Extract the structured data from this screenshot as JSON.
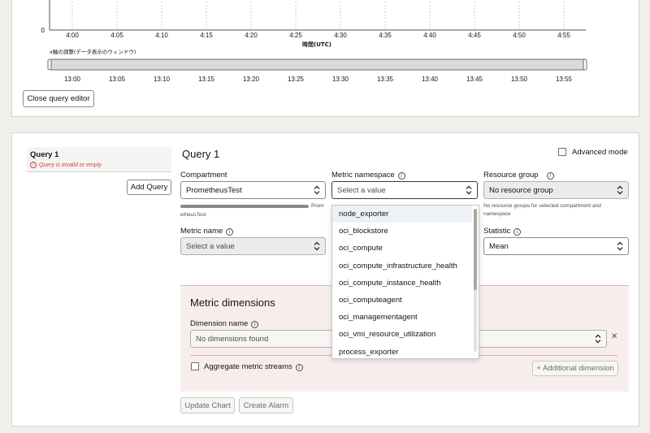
{
  "chart": {
    "x_ticks_local": [
      "4:00",
      "4:05",
      "4:10",
      "4:15",
      "4:20",
      "4:25",
      "4:30",
      "4:35",
      "4:40",
      "4:45",
      "4:50",
      "4:55"
    ],
    "y_zero_label": "0",
    "x_axis_title": "時間(UTC)",
    "window_title": "x軸の調整(データ表示のウィンドウ)",
    "window_ticks": [
      "13:00",
      "13:05",
      "13:10",
      "13:15",
      "13:20",
      "13:25",
      "13:30",
      "13:35",
      "13:40",
      "13:45",
      "13:50",
      "13:55"
    ]
  },
  "close_editor_label": "Close query editor",
  "sidebar": {
    "query_label": "Query 1",
    "error_text": "Query is invalid or empty",
    "add_query_label": "Add Query"
  },
  "query": {
    "title": "Query 1",
    "advanced_mode_label": "Advanced mode",
    "compartment_label": "Compartment",
    "compartment_value": "PrometheusTest",
    "compartment_path_tail": "Prom",
    "compartment_path_end": "etheusTest",
    "namespace_label": "Metric namespace",
    "namespace_placeholder": "Select a value",
    "resource_group_label": "Resource group",
    "resource_group_value": "No resource group",
    "resource_group_hint_1": "No resource groups for selected compartment and",
    "resource_group_hint_2": "namespace",
    "metric_name_label": "Metric name",
    "metric_name_placeholder": "Select a value",
    "statistic_label": "Statistic",
    "statistic_value": "Mean"
  },
  "namespace_options": [
    "node_exporter",
    "oci_blockstore",
    "oci_compute",
    "oci_compute_infrastructure_health",
    "oci_compute_instance_health",
    "oci_computeagent",
    "oci_managementagent",
    "oci_vmi_resource_utilization",
    "process_exporter"
  ],
  "dimensions": {
    "title": "Metric dimensions",
    "dimension_name_label": "Dimension name",
    "dimension_placeholder": "No dimensions found",
    "remove_symbol": "✕",
    "aggregate_label": "Aggregate metric streams",
    "additional_label": "+ Additional dimension"
  },
  "actions": {
    "update_chart": "Update Chart",
    "create_alarm": "Create Alarm"
  },
  "colors": {
    "error": "#c74634",
    "dimension_bg": "#f8eded"
  }
}
